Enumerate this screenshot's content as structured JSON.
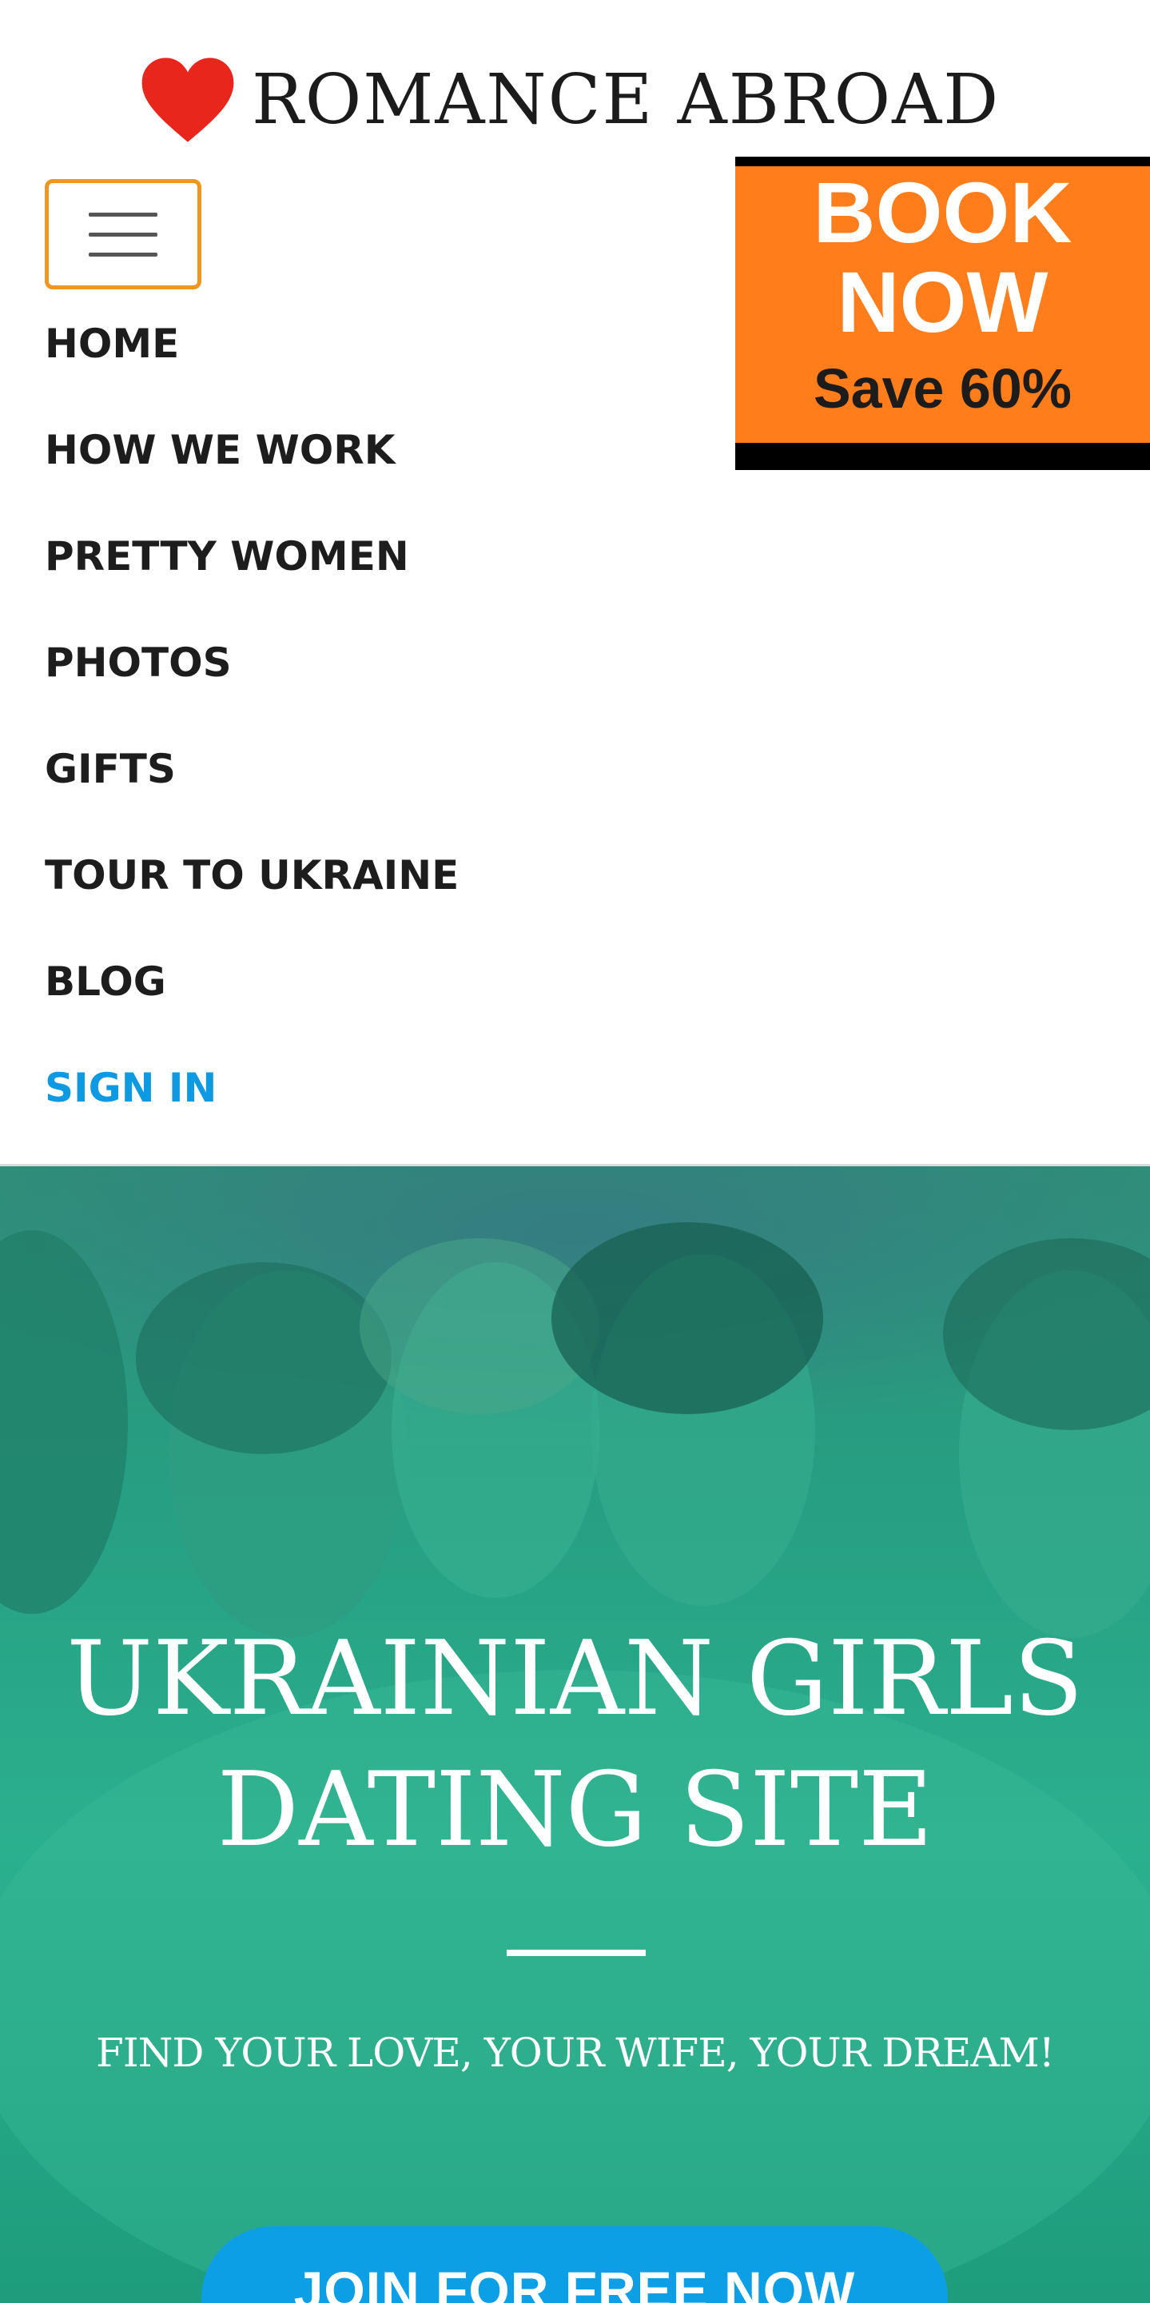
{
  "header": {
    "brand_name": "ROMANCE ABROAD",
    "logo_icon": "heart-icon",
    "menu_icon": "hamburger-menu-icon"
  },
  "promo": {
    "line1": "BOOK",
    "line2": "NOW",
    "discount": "Save 60%",
    "background_color": "#ff7d1a"
  },
  "nav": {
    "items": [
      {
        "label": "HOME"
      },
      {
        "label": "HOW WE WORK"
      },
      {
        "label": "PRETTY WOMEN"
      },
      {
        "label": "PHOTOS"
      },
      {
        "label": "GIFTS"
      },
      {
        "label": "TOUR TO UKRAINE"
      },
      {
        "label": "BLOG"
      },
      {
        "label": "SIGN IN"
      }
    ],
    "accent_color": "#0e9ae3"
  },
  "hero": {
    "title_line1": "UKRAINIAN GIRLS",
    "title_line2": "DATING SITE",
    "subtitle": "FIND YOUR LOVE, YOUR WIFE, YOUR DREAM!",
    "cta_label": "JOIN FOR FREE NOW",
    "overlay_color": "#2bb08e"
  }
}
